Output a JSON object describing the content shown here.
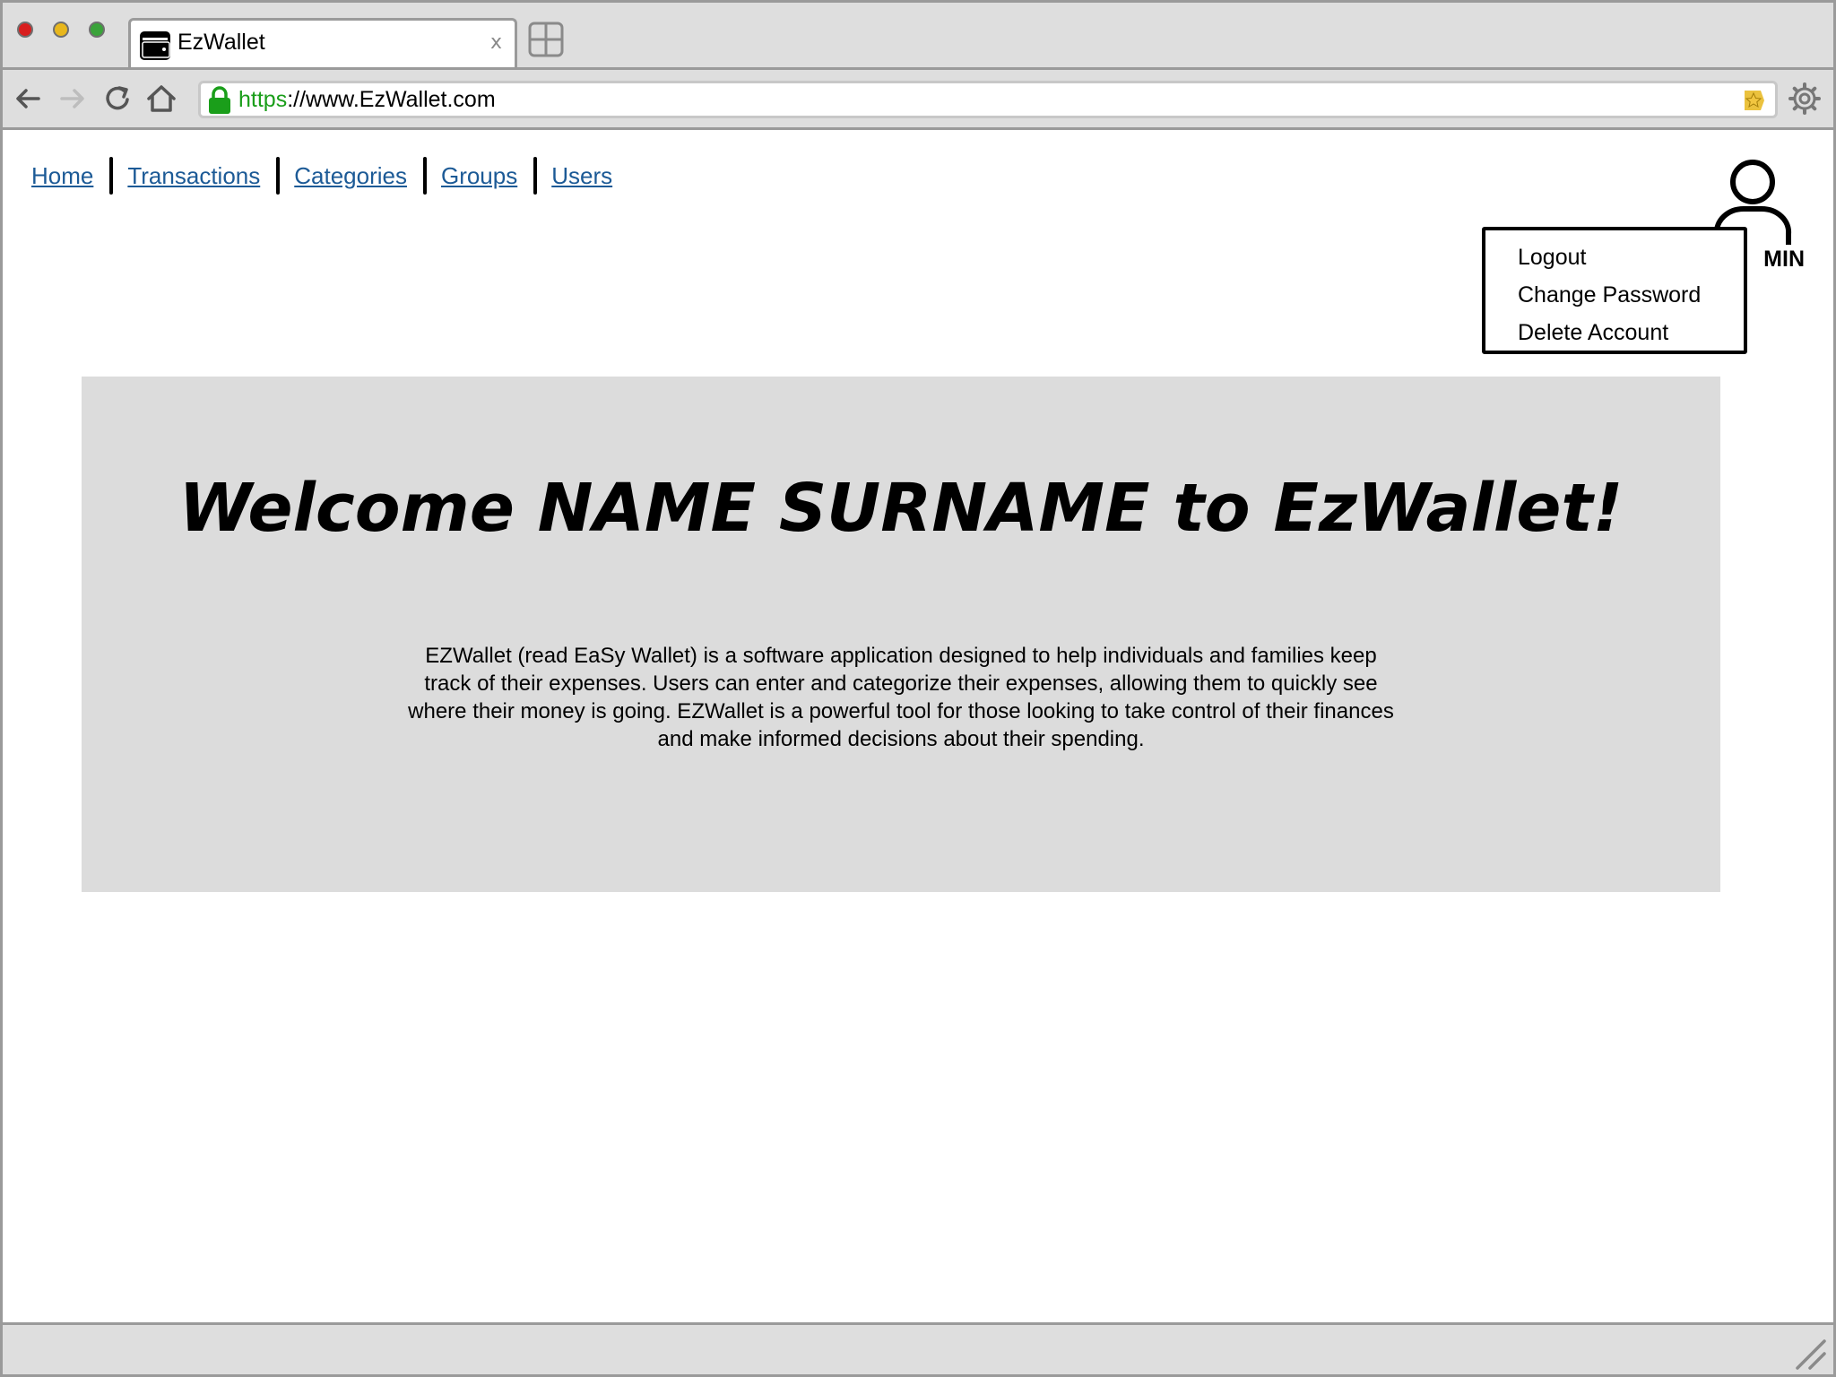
{
  "browser": {
    "tab_title": "EzWallet",
    "tab_close": "x",
    "url_scheme": "https",
    "url_rest": "://www.EzWallet.com"
  },
  "nav": {
    "items": [
      {
        "label": "Home"
      },
      {
        "label": "Transactions"
      },
      {
        "label": "Categories"
      },
      {
        "label": "Groups"
      },
      {
        "label": "Users"
      }
    ]
  },
  "user": {
    "role_label": "MIN"
  },
  "user_menu": {
    "items": [
      {
        "label": "Logout"
      },
      {
        "label": "Change Password"
      },
      {
        "label": "Delete Account"
      }
    ]
  },
  "hero": {
    "welcome_prefix": "Welcome ",
    "user_name": "NAME SURNAME",
    "welcome_suffix": " to EzWallet!",
    "description": "EZWallet (read EaSy Wallet) is a software application designed to help individuals and families keep track of their expenses. Users can enter and categorize their expenses, allowing them to quickly see where their money is going. EZWallet is a powerful tool for those looking to take control of their finances and make informed decisions about their spending."
  },
  "colors": {
    "link": "#1c5a96",
    "hero_background": "#dcdcdc",
    "chrome_background": "#dedede",
    "secure_scheme": "#1a9e1a"
  },
  "icons": [
    "wallet-icon",
    "new-tab-icon",
    "back-arrow-icon",
    "forward-arrow-icon",
    "reload-icon",
    "home-icon",
    "lock-icon",
    "bookmark-star-icon",
    "settings-gear-icon",
    "user-avatar-icon",
    "resize-grip-icon"
  ]
}
